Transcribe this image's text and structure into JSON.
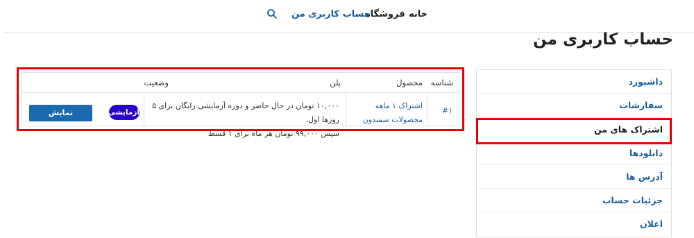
{
  "nav": {
    "items": [
      {
        "label": "خانه",
        "active": false
      },
      {
        "label": "فروشگاه",
        "active": false
      },
      {
        "label": "حساب کاربری من",
        "active": true
      }
    ],
    "search_icon": "search-icon"
  },
  "page": {
    "title": "حساب کاربری من"
  },
  "sidebar": {
    "items": [
      {
        "label": "داشبورد"
      },
      {
        "label": "سفارشات"
      },
      {
        "label": "اشتراک های من"
      },
      {
        "label": "دانلودها"
      },
      {
        "label": "آدرس ها"
      },
      {
        "label": "جزئیات حساب"
      },
      {
        "label": "اعلان"
      }
    ]
  },
  "table": {
    "headers": {
      "id": "شناسه",
      "product": "محصول",
      "plan": "پلن",
      "status": "وضعیت"
    },
    "rows": [
      {
        "id": "#۱",
        "product_line1": "اشتراک ۱ ماهه",
        "product_line2": "محصولات سمندون",
        "plan_line1": "۱۰,۰۰۰ تومان در حال حاضر و دوره آزمایشی رایگان برای ۵ روزها اول،",
        "plan_line2": "سپس ۹۹,۰۰۰ تومان هر ماه برای ۱ قسط",
        "status": "آزمایشی",
        "action": "نمایش"
      }
    ]
  },
  "colors": {
    "accent": "#1a5fa0",
    "badge": "#2b00c9",
    "highlight": "#e60000"
  }
}
